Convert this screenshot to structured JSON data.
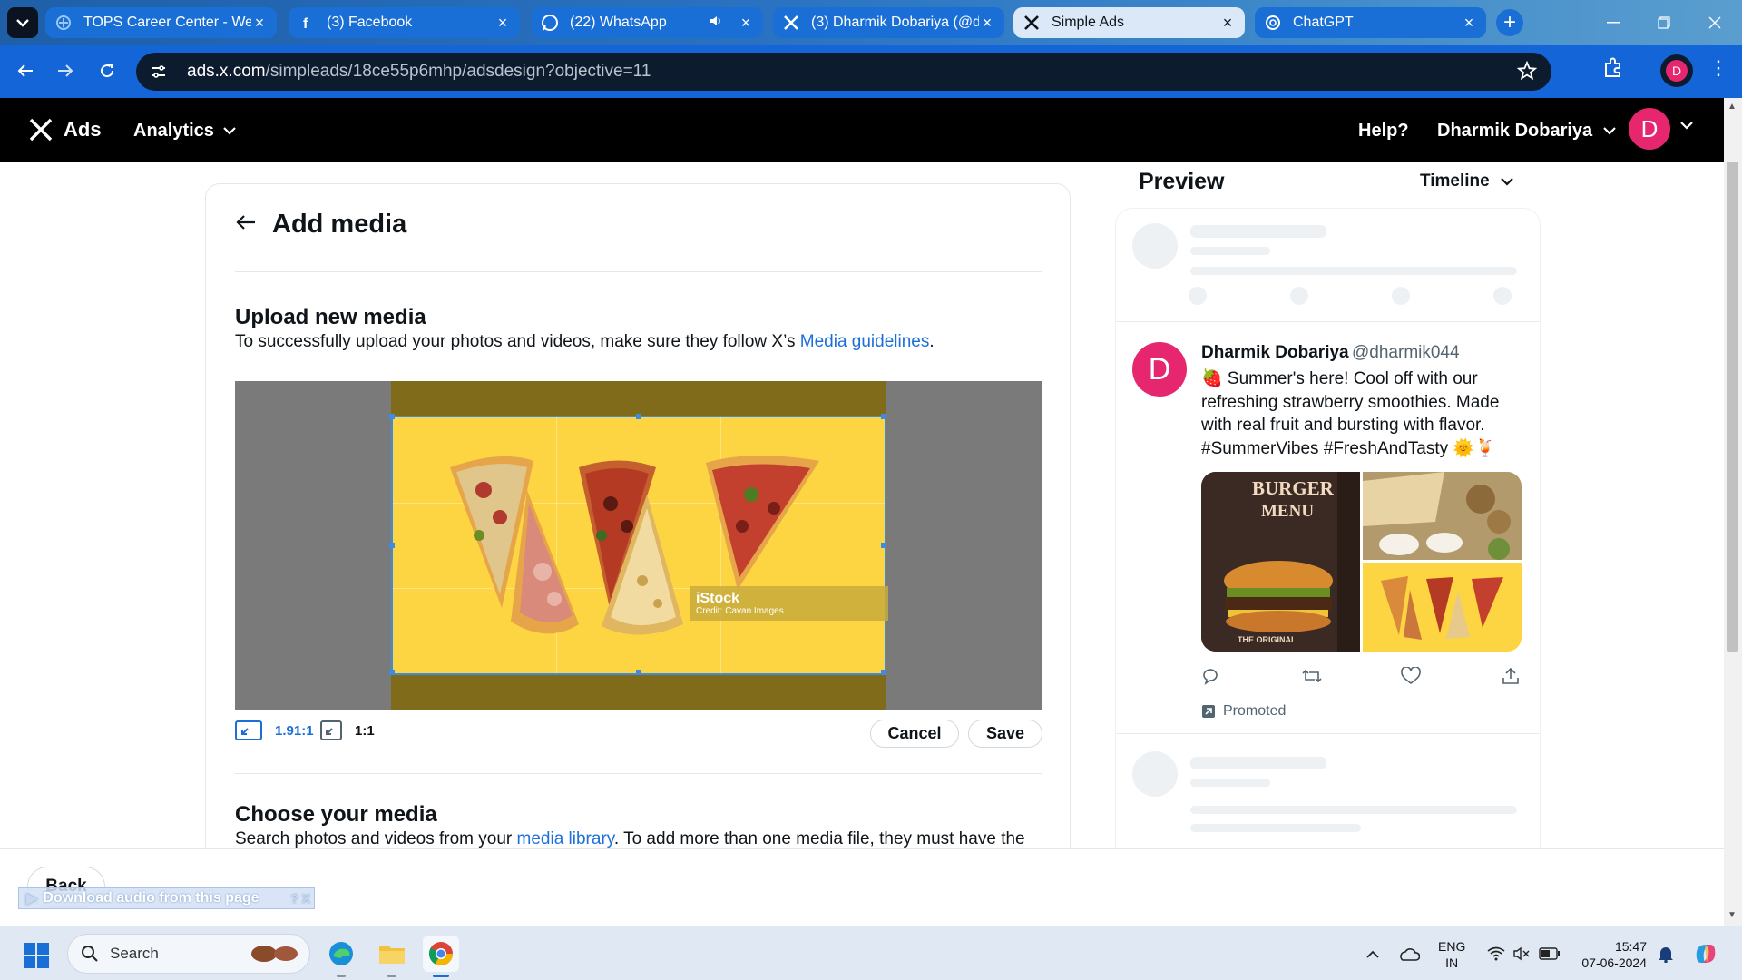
{
  "browser": {
    "tabs": [
      {
        "title": "TOPS Career Center - Welc",
        "icon": "tops-icon",
        "active": false
      },
      {
        "title": "(3) Facebook",
        "icon": "facebook-icon",
        "active": false
      },
      {
        "title": "(22) WhatsApp",
        "icon": "whatsapp-icon",
        "active": false
      },
      {
        "title": "(3) Dharmik Dobariya (@d",
        "icon": "x-icon",
        "active": false
      },
      {
        "title": "Simple Ads",
        "icon": "x-icon",
        "active": true
      },
      {
        "title": "ChatGPT",
        "icon": "chatgpt-icon",
        "active": false
      }
    ],
    "url_host": "ads.x.com",
    "url_path": "/simpleads/18ce55p6mhp/adsdesign?objective=11",
    "profile_initial": "D"
  },
  "header": {
    "brand": "Ads",
    "analytics": "Analytics",
    "help": "Help?",
    "account_name": "Dharmik Dobariya",
    "avatar_initial": "D"
  },
  "editor": {
    "title": "Add media",
    "upload_heading": "Upload new media",
    "upload_text_before": "To successfully upload your photos and videos, make sure they follow X’s ",
    "upload_link": "Media guidelines",
    "upload_text_after": ".",
    "watermark_brand": "iStock",
    "watermark_credit": "Credit: Cavan Images",
    "ratio_wide": "1.91:1",
    "ratio_square": "1:1",
    "cancel": "Cancel",
    "save": "Save",
    "choose_heading": "Choose your media",
    "choose_text_before": "Search photos and videos from your ",
    "choose_link": "media library",
    "choose_text_after": ". To add more than one media file, they must have the"
  },
  "preview": {
    "title": "Preview",
    "mode": "Timeline",
    "tweet": {
      "name": "Dharmik Dobariya",
      "handle": "@dharmik044",
      "avatar_initial": "D",
      "text": "🍓 Summer's here! Cool off with our refreshing strawberry smoothies. Made with real fruit and bursting with flavor. #SummerVibes #FreshAndTasty 🌞🍹",
      "burger_title": "BURGER",
      "burger_sub": "MENU",
      "burger_footer": "THE ORIGINAL",
      "promoted": "Promoted"
    }
  },
  "footer": {
    "back": "Back",
    "download_overlay": "Download audio from this page",
    "overlay_controls": "? X"
  },
  "taskbar": {
    "search": "Search",
    "lang_top": "ENG",
    "lang_bottom": "IN",
    "time": "15:47",
    "date": "07-06-2024"
  },
  "colors": {
    "accent": "#1d6fd8",
    "avatar": "#e6266e",
    "crop_bg": "#fdd441"
  }
}
